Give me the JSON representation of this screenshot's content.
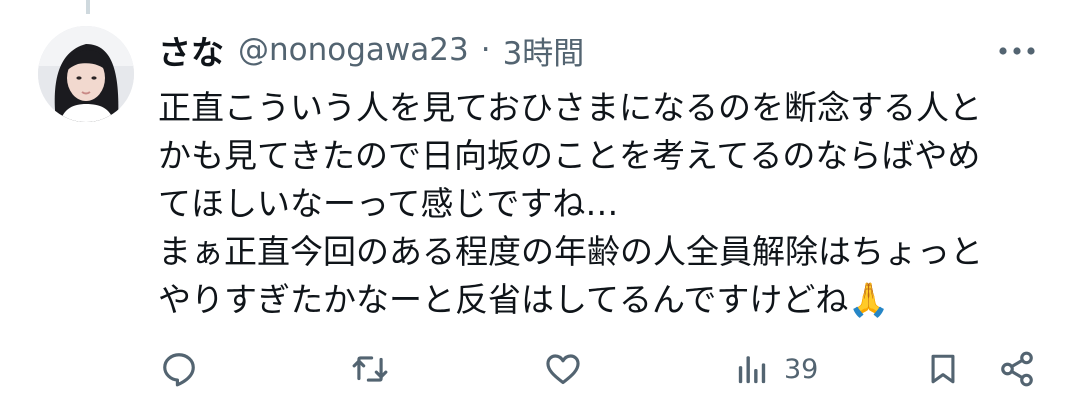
{
  "tweet": {
    "author_name": "さな",
    "author_handle": "@nonogawa23",
    "separator": "·",
    "timestamp": "3時間",
    "text": "正直こういう人を見ておひさまになるのを断念する人と\nかも見てきたので日向坂のことを考えてるのならばやめ\nてほしいなーって感じですね…\nまぁ正直今回のある程度の年齢の人全員解除はちょっと\nやりすぎたかなーと反省はしてるんですけどね🙏",
    "emoji_icon": "folded-hands-icon"
  },
  "actions": {
    "reply_icon": "reply-icon",
    "retweet_icon": "retweet-icon",
    "like_icon": "like-icon",
    "views_icon": "views-icon",
    "views_count": "39",
    "bookmark_icon": "bookmark-icon",
    "share_icon": "share-icon"
  },
  "more_icon": "more-icon",
  "colors": {
    "text_primary": "#0f1419",
    "text_secondary": "#536471",
    "thread_line": "#cfd9de",
    "background": "#ffffff"
  }
}
